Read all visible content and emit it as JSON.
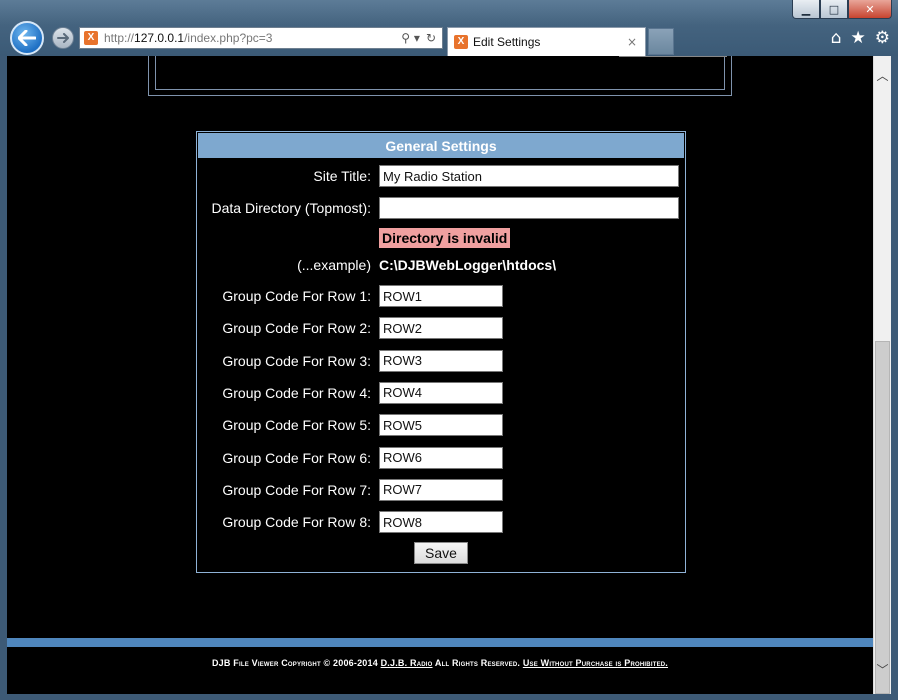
{
  "browser": {
    "url_prefix": "http://",
    "url_host": "127.0.0.1",
    "url_path": "/index.php?pc=3",
    "tab_title": "Edit Settings",
    "tab_close": "×",
    "fav_glyph": "X"
  },
  "window_controls": {
    "minimize": "▁",
    "maximize": "□",
    "close": "✕"
  },
  "tools": {
    "home": "⌂",
    "favorites": "★",
    "settings": "⚙"
  },
  "panel": {
    "title": "General Settings",
    "site_title_label": "Site Title:",
    "site_title_value": "My Radio Station",
    "data_dir_label": "Data Directory (Topmost):",
    "data_dir_value": "",
    "error_text": "Directory is invalid",
    "example_label": "(...example)",
    "example_value": "C:\\DJBWebLogger\\htdocs\\",
    "group_rows": [
      {
        "label": "Group Code For Row 1:",
        "value": "ROW1"
      },
      {
        "label": "Group Code For Row 2:",
        "value": "ROW2"
      },
      {
        "label": "Group Code For Row 3:",
        "value": "ROW3"
      },
      {
        "label": "Group Code For Row 4:",
        "value": "ROW4"
      },
      {
        "label": "Group Code For Row 5:",
        "value": "ROW5"
      },
      {
        "label": "Group Code For Row 6:",
        "value": "ROW6"
      },
      {
        "label": "Group Code For Row 7:",
        "value": "ROW7"
      },
      {
        "label": "Group Code For Row 8:",
        "value": "ROW8"
      }
    ],
    "save_label": "Save"
  },
  "footer": {
    "text_before": "DJB File Viewer Copyright © 2006-2014",
    "link_owner": "D.J.B. Radio",
    "text_middle": "All Rights Reserved.",
    "link_notice": "Use Without Purchase is Prohibited."
  },
  "scrollbar": {
    "up": "︿",
    "down": "﹀"
  },
  "colors": {
    "panel_header": "#7ea8cf",
    "error_bg": "#f0a0a0",
    "footer_bar": "#4f86bc"
  }
}
